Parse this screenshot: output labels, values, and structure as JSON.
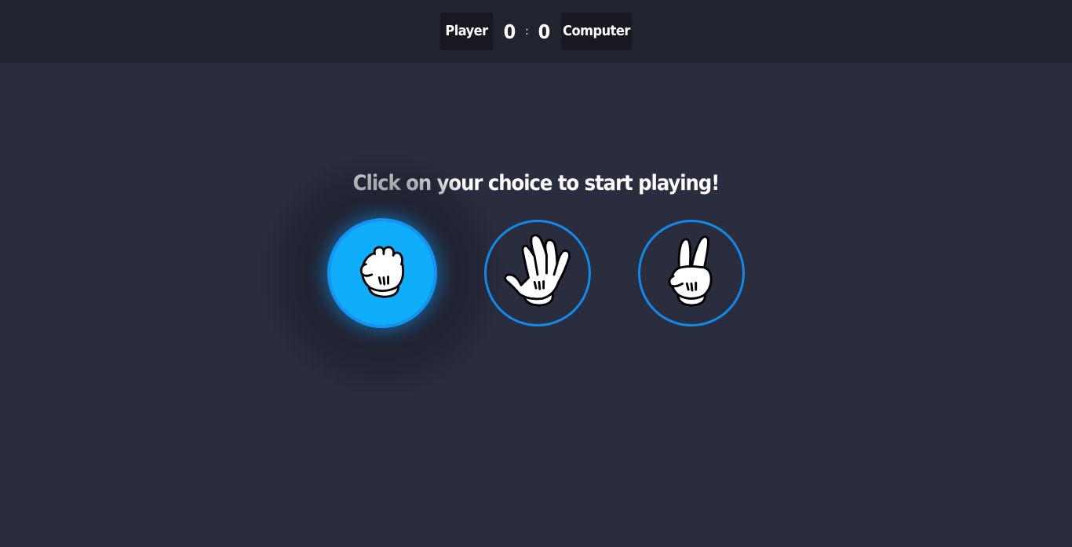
{
  "scoreboard": {
    "player_label": "Player",
    "player_score": "0",
    "separator": ":",
    "computer_score": "0",
    "computer_label": "Computer"
  },
  "prompt": "Click on your choice to start playing!",
  "choices": [
    {
      "id": "rock",
      "icon": "fist-icon",
      "selected": true
    },
    {
      "id": "paper",
      "icon": "open-hand-icon",
      "selected": false
    },
    {
      "id": "scissors",
      "icon": "peace-hand-icon",
      "selected": false
    }
  ],
  "colors": {
    "background": "#2a2d3e",
    "topbar": "#212331",
    "accent": "#0fadfa",
    "ring": "#1388e6"
  }
}
